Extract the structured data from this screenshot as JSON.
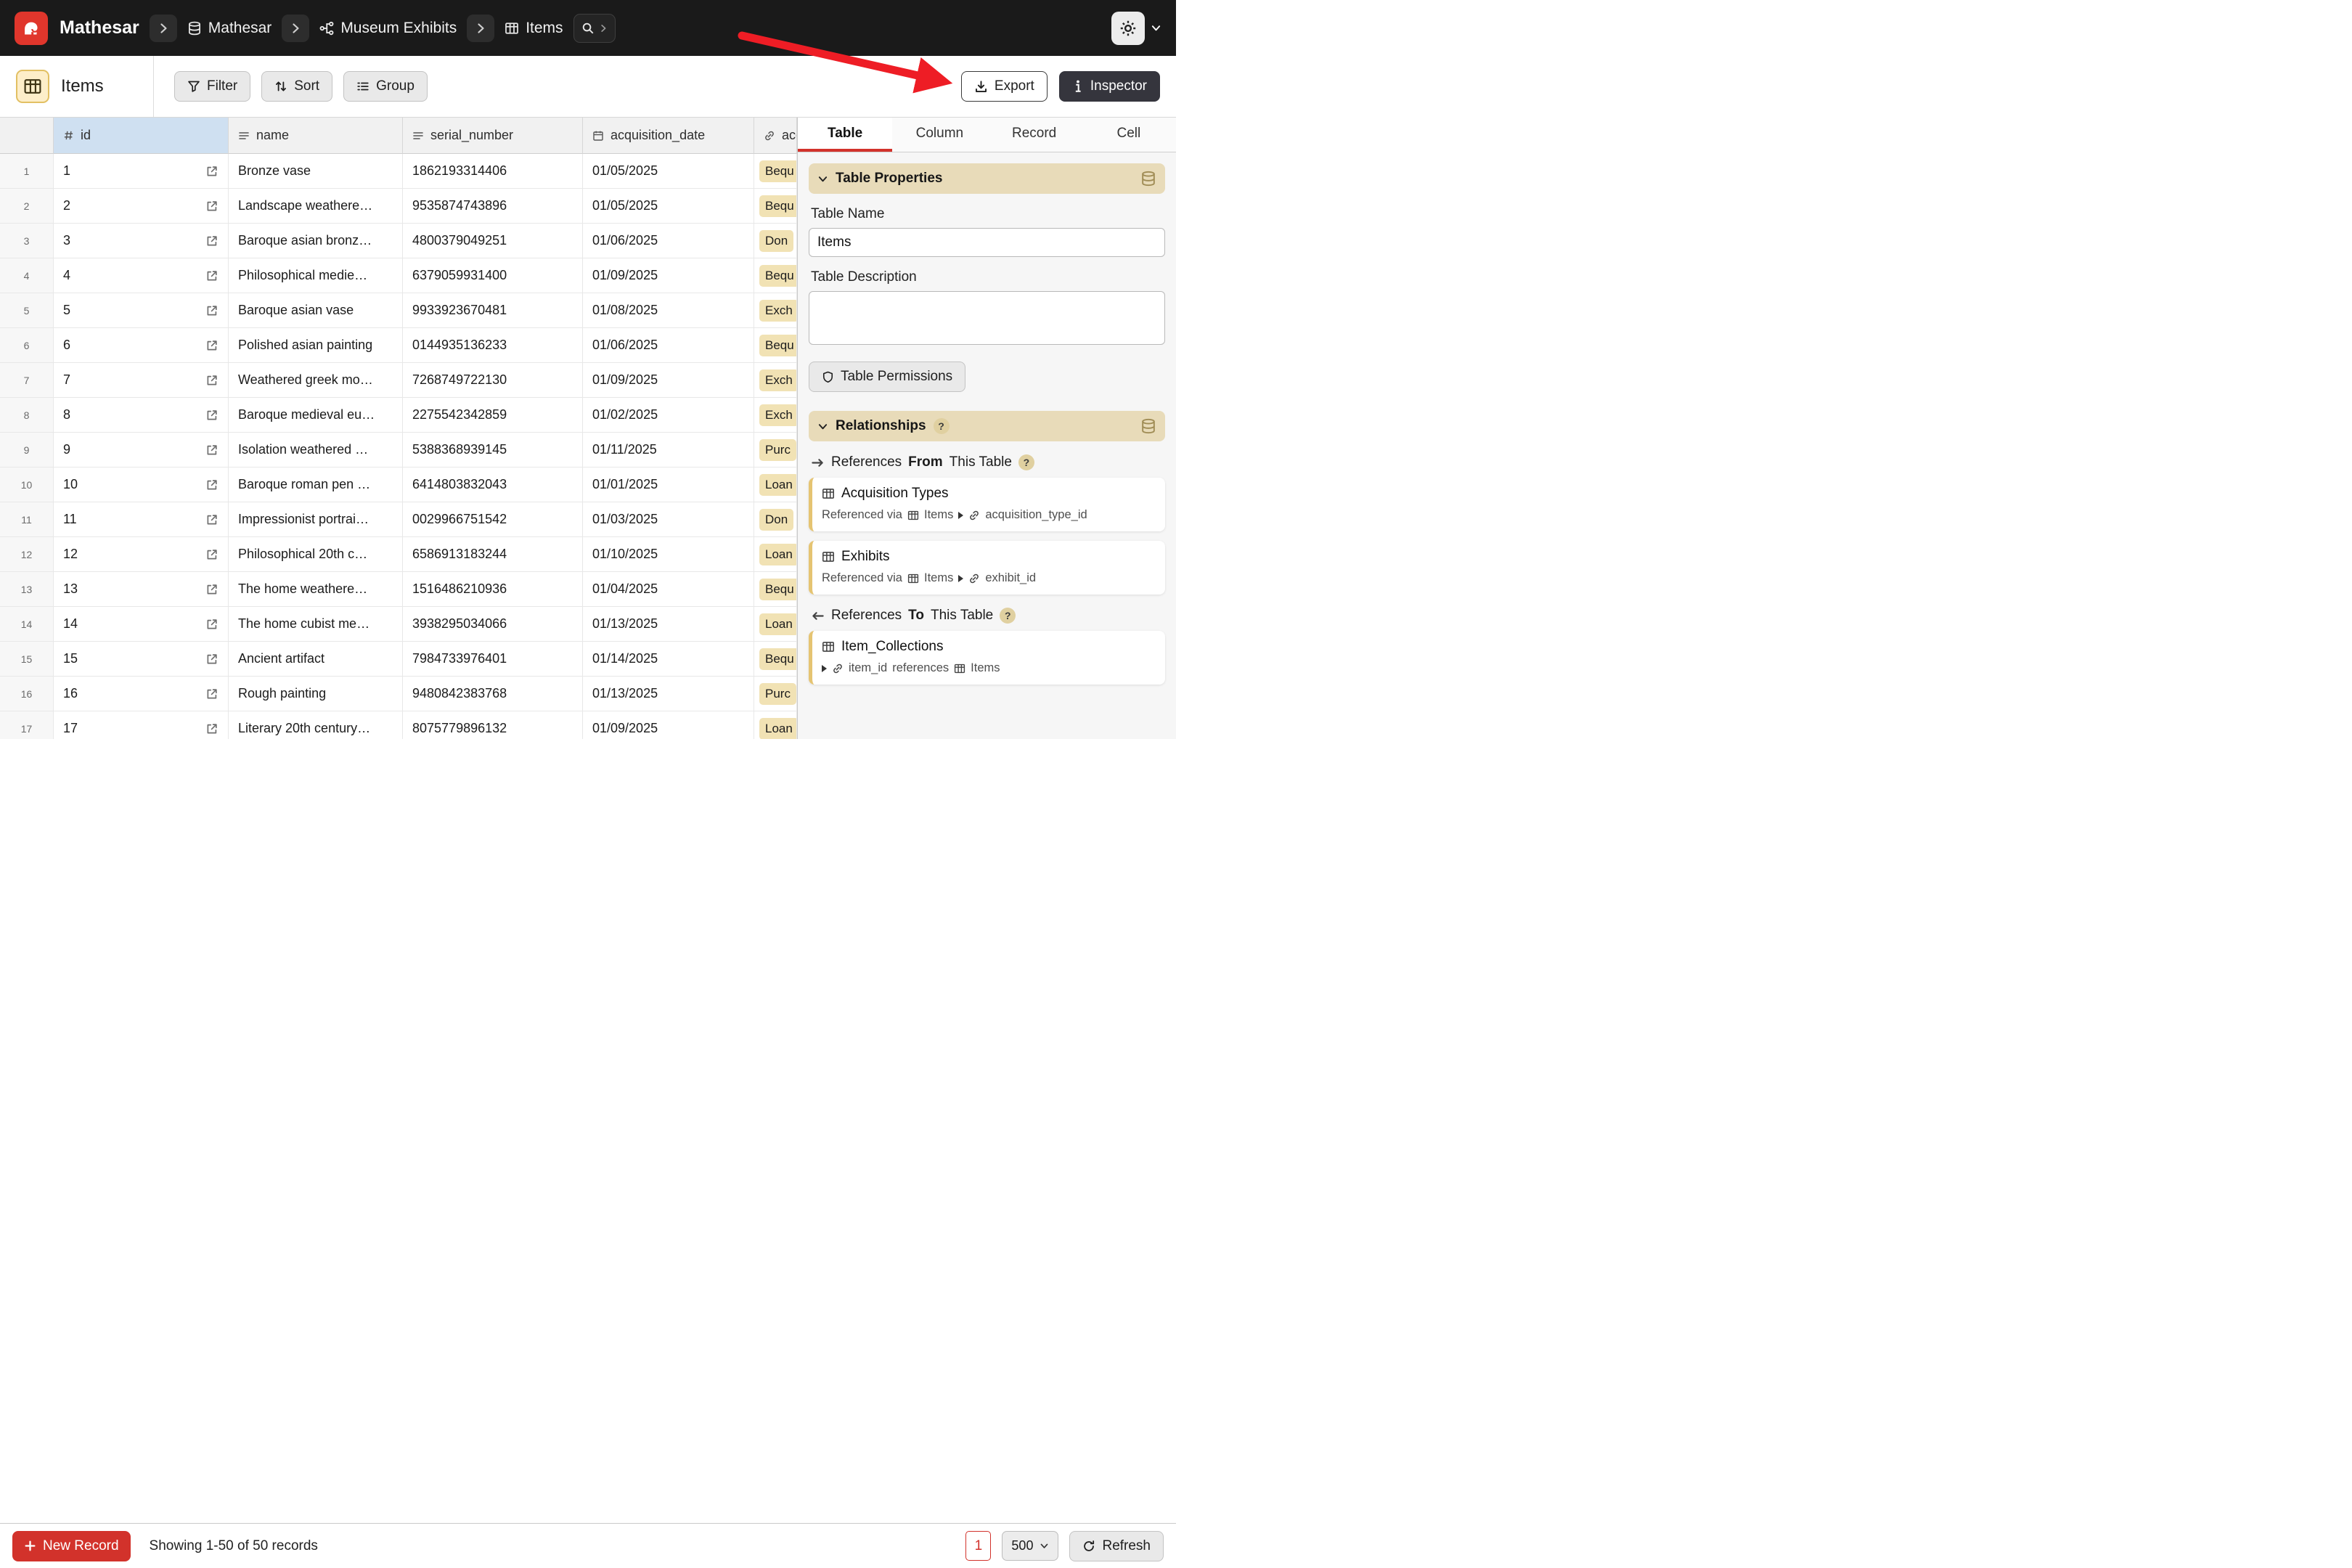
{
  "topbar": {
    "brand": "Mathesar",
    "breadcrumbs": [
      {
        "label": "Mathesar"
      },
      {
        "label": "Museum Exhibits"
      },
      {
        "label": "Items"
      }
    ]
  },
  "toolbar": {
    "table_title": "Items",
    "filter": "Filter",
    "sort": "Sort",
    "group": "Group",
    "export": "Export",
    "inspector": "Inspector"
  },
  "table": {
    "columns": [
      {
        "label": "id"
      },
      {
        "label": "name"
      },
      {
        "label": "serial_number"
      },
      {
        "label": "acquisition_date"
      },
      {
        "label": "acc"
      }
    ],
    "rows": [
      {
        "num": "1",
        "id": "1",
        "name": "Bronze vase",
        "serial": "1862193314406",
        "date": "01/05/2025",
        "acc": "Bequ"
      },
      {
        "num": "2",
        "id": "2",
        "name": "Landscape weathere…",
        "serial": "9535874743896",
        "date": "01/05/2025",
        "acc": "Bequ"
      },
      {
        "num": "3",
        "id": "3",
        "name": "Baroque asian bronz…",
        "serial": "4800379049251",
        "date": "01/06/2025",
        "acc": "Don"
      },
      {
        "num": "4",
        "id": "4",
        "name": "Philosophical medie…",
        "serial": "6379059931400",
        "date": "01/09/2025",
        "acc": "Bequ"
      },
      {
        "num": "5",
        "id": "5",
        "name": "Baroque asian vase",
        "serial": "9933923670481",
        "date": "01/08/2025",
        "acc": "Exch"
      },
      {
        "num": "6",
        "id": "6",
        "name": "Polished asian painting",
        "serial": "0144935136233",
        "date": "01/06/2025",
        "acc": "Bequ"
      },
      {
        "num": "7",
        "id": "7",
        "name": "Weathered greek mo…",
        "serial": "7268749722130",
        "date": "01/09/2025",
        "acc": "Exch"
      },
      {
        "num": "8",
        "id": "8",
        "name": "Baroque medieval eu…",
        "serial": "2275542342859",
        "date": "01/02/2025",
        "acc": "Exch"
      },
      {
        "num": "9",
        "id": "9",
        "name": "Isolation weathered …",
        "serial": "5388368939145",
        "date": "01/11/2025",
        "acc": "Purc"
      },
      {
        "num": "10",
        "id": "10",
        "name": "Baroque roman pen …",
        "serial": "6414803832043",
        "date": "01/01/2025",
        "acc": "Loan"
      },
      {
        "num": "11",
        "id": "11",
        "name": "Impressionist portrai…",
        "serial": "0029966751542",
        "date": "01/03/2025",
        "acc": "Don"
      },
      {
        "num": "12",
        "id": "12",
        "name": "Philosophical 20th c…",
        "serial": "6586913183244",
        "date": "01/10/2025",
        "acc": "Loan"
      },
      {
        "num": "13",
        "id": "13",
        "name": "The home weathere…",
        "serial": "1516486210936",
        "date": "01/04/2025",
        "acc": "Bequ"
      },
      {
        "num": "14",
        "id": "14",
        "name": "The home cubist me…",
        "serial": "3938295034066",
        "date": "01/13/2025",
        "acc": "Loan"
      },
      {
        "num": "15",
        "id": "15",
        "name": "Ancient artifact",
        "serial": "7984733976401",
        "date": "01/14/2025",
        "acc": "Bequ"
      },
      {
        "num": "16",
        "id": "16",
        "name": "Rough painting",
        "serial": "9480842383768",
        "date": "01/13/2025",
        "acc": "Purc"
      },
      {
        "num": "17",
        "id": "17",
        "name": "Literary 20th century…",
        "serial": "8075779896132",
        "date": "01/09/2025",
        "acc": "Loan"
      }
    ]
  },
  "inspector": {
    "tabs": [
      "Table",
      "Column",
      "Record",
      "Cell"
    ],
    "table_properties": {
      "title": "Table Properties",
      "name_label": "Table Name",
      "name_value": "Items",
      "description_label": "Table Description",
      "permissions_label": "Table Permissions"
    },
    "relationships": {
      "title": "Relationships",
      "refs_from": {
        "pre": "References",
        "emph": "From",
        "post": "This Table"
      },
      "from_cards": [
        {
          "table": "Acquisition Types",
          "via": "Referenced via",
          "via_table": "Items",
          "column": "acquisition_type_id"
        },
        {
          "table": "Exhibits",
          "via": "Referenced via",
          "via_table": "Items",
          "column": "exhibit_id"
        }
      ],
      "refs_to": {
        "pre": "References",
        "emph": "To",
        "post": "This Table"
      },
      "to_cards": [
        {
          "table": "Item_Collections",
          "column": "item_id",
          "mid": "references",
          "target": "Items"
        }
      ]
    }
  },
  "statusbar": {
    "new_record": "New Record",
    "showing": "Showing 1-50 of 50 records",
    "page": "1",
    "page_size": "500",
    "refresh": "Refresh"
  },
  "colors": {
    "accent_red": "#d2322b",
    "annotation_red": "#ee1d25",
    "topbar_bg": "#1a1a1a",
    "tan_section": "#e8dbb9",
    "selected_header_blue": "#cfe0f1",
    "chip_tan": "#f1e2b4"
  }
}
